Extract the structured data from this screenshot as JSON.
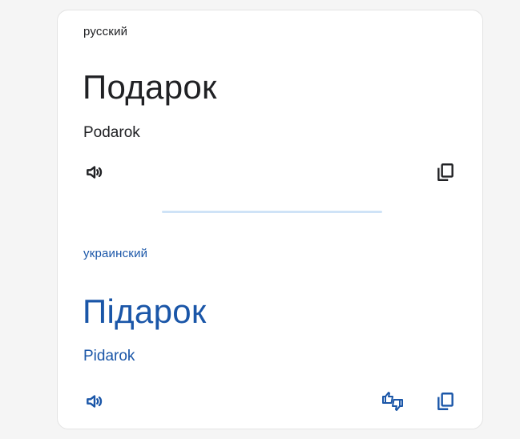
{
  "source": {
    "language": "русский",
    "word": "Подарок",
    "transliteration": "Podarok",
    "speaker_icon": "speaker-icon",
    "copy_icon": "copy-icon"
  },
  "target": {
    "language": "украинский",
    "word": "Підарок",
    "transliteration": "Pidarok",
    "speaker_icon": "speaker-icon",
    "feedback_icon": "thumbs-feedback-icon",
    "copy_icon": "copy-icon"
  },
  "colors": {
    "source_text": "#202124",
    "target_text": "#1a56a8",
    "divider": "#cfe3f7"
  }
}
